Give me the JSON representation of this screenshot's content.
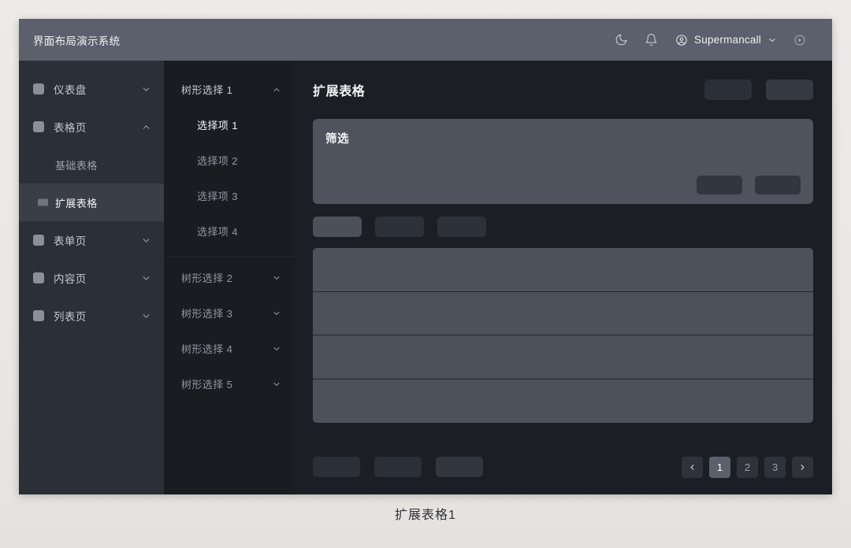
{
  "window": {
    "title": "界面布局演示系统"
  },
  "topbar": {
    "icons": [
      {
        "name": "moon-icon",
        "glyph": "moon"
      },
      {
        "name": "bell-icon",
        "glyph": "bell"
      }
    ],
    "user": {
      "avatar_icon": "user-circle-icon",
      "name": "Supermancall",
      "chevron": "chevron-down-icon"
    },
    "logout_icon": "power-circle-icon"
  },
  "sidebar": {
    "items": [
      {
        "label": "仪表盘",
        "icon": "square-placeholder-icon",
        "chevron": "chevron-down-icon",
        "expanded": false
      },
      {
        "label": "表格页",
        "icon": "square-placeholder-icon",
        "chevron": "chevron-up-icon",
        "expanded": true
      },
      {
        "label": "表单页",
        "icon": "square-placeholder-icon",
        "chevron": "chevron-down-icon",
        "expanded": false
      },
      {
        "label": "内容页",
        "icon": "square-placeholder-icon",
        "chevron": "chevron-down-icon",
        "expanded": false
      },
      {
        "label": "列表页",
        "icon": "square-placeholder-icon",
        "chevron": "chevron-down-icon",
        "expanded": false
      }
    ],
    "subitems": [
      {
        "label": "基础表格",
        "active": false
      },
      {
        "label": "扩展表格",
        "active": true
      }
    ]
  },
  "tree": {
    "group1": {
      "label": "树形选择 1",
      "chevron": "chevron-up-icon"
    },
    "leaves": [
      {
        "label": "选择项 1",
        "active": true
      },
      {
        "label": "选择项 2",
        "active": false
      },
      {
        "label": "选择项 3",
        "active": false
      },
      {
        "label": "选择项 4",
        "active": false
      }
    ],
    "groups": [
      {
        "label": "树形选择 2",
        "chevron": "chevron-down-icon"
      },
      {
        "label": "树形选择 3",
        "chevron": "chevron-down-icon"
      },
      {
        "label": "树形选择 4",
        "chevron": "chevron-down-icon"
      },
      {
        "label": "树形选择 5",
        "chevron": "chevron-down-icon"
      }
    ]
  },
  "main": {
    "page_title": "扩展表格",
    "header_buttons": [
      {
        "label": "",
        "name": "header-action-button-1"
      },
      {
        "label": "",
        "name": "header-action-button-2"
      }
    ],
    "filter": {
      "title": "筛选",
      "buttons": [
        {
          "label": "",
          "name": "filter-reset-button"
        },
        {
          "label": "",
          "name": "filter-submit-button"
        }
      ]
    },
    "toolbar_buttons": [
      {
        "label": "",
        "name": "toolbar-button-1",
        "primary": true
      },
      {
        "label": "",
        "name": "toolbar-button-2",
        "primary": false
      },
      {
        "label": "",
        "name": "toolbar-button-3",
        "primary": false
      }
    ],
    "table": {
      "rows": [
        "",
        "",
        "",
        ""
      ]
    },
    "footer_buttons": [
      {
        "label": "",
        "name": "footer-button-1"
      },
      {
        "label": "",
        "name": "footer-button-2"
      },
      {
        "label": "",
        "name": "footer-button-3"
      }
    ],
    "pagination": {
      "prev": "‹",
      "pages": [
        "1",
        "2",
        "3"
      ],
      "current": "1",
      "next": "›"
    }
  },
  "caption": "扩展表格1",
  "colors": {
    "page_background": "#eceae7",
    "topbar": "#5b606c",
    "sidebar": "#2b2f37",
    "tree_panel": "#191c21",
    "content": "#1b1e24",
    "filter_card": "#4e535e",
    "table": "#4c515c",
    "active_accent": "#5a606c"
  }
}
